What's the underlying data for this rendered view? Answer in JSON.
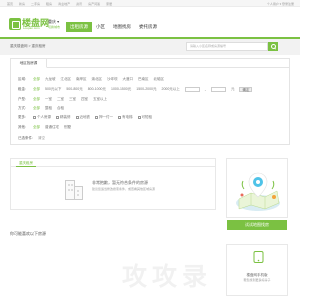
{
  "topnav": {
    "links": [
      "首页",
      "新房",
      "二手房",
      "租房",
      "商业地产",
      "资讯",
      "房产问答",
      "家居"
    ],
    "login": "个人用户 ▾ 登录注册"
  },
  "header": {
    "logo_name": "楼盘网",
    "logo_url": "Loupan.com",
    "city": "重庆 ▾",
    "city_switch": "切换城市",
    "nav": [
      {
        "label": "出租房源",
        "active": true
      },
      {
        "label": "小区",
        "active": false
      },
      {
        "label": "地图找房",
        "active": false
      },
      {
        "label": "委托房源",
        "active": false
      }
    ]
  },
  "breadcrumb": "重庆楼盘网 > 重庆租房",
  "search": {
    "placeholder": "请输入小区名称或房源编号"
  },
  "filter": {
    "tab": "地区找房源",
    "area": {
      "label": "区域:",
      "options": [
        "全部",
        "九龙坡",
        "江北区",
        "南岸区",
        "渝北区",
        "沙坪坝",
        "大渡口",
        "巴南区",
        "北碚区"
      ]
    },
    "price": {
      "label": "租金:",
      "options": [
        "全部",
        "500元以下",
        "500-800元",
        "800-1000元",
        "1000-1500元",
        "1500-2000元",
        "2000元以上"
      ],
      "unit": "元",
      "ok": "确定"
    },
    "rooms": {
      "label": "户型:",
      "options": [
        "全部",
        "一室",
        "二室",
        "三室",
        "四室",
        "五室以上"
      ]
    },
    "type": {
      "label": "方式:",
      "options": [
        "全部",
        "整租",
        "合租"
      ]
    },
    "more": {
      "label": "更多:",
      "checks": [
        "个人房源",
        "精装修",
        "近地铁",
        "押一付一",
        "有电梯",
        "可短租"
      ]
    },
    "extra": {
      "label": "其他:",
      "options": [
        "全部",
        "普通住宅",
        "别墅"
      ]
    },
    "selected_label": "已选条件:",
    "clear": "清空"
  },
  "results": {
    "tab": "重庆租房",
    "empty_title": "非常抱歉，暂无符合条件的房源",
    "empty_hint": "建议您适当修改搜索条件，或查看其他区域房源"
  },
  "guess_title": "你可能喜欢以下房源",
  "sidebar": {
    "map_button": "试试地图找房",
    "promo_title": "楼盘网手机版",
    "promo_text": "帮您找到更多好房子"
  },
  "watermark": "攻攻录",
  "colors": {
    "accent": "#7bc142"
  }
}
